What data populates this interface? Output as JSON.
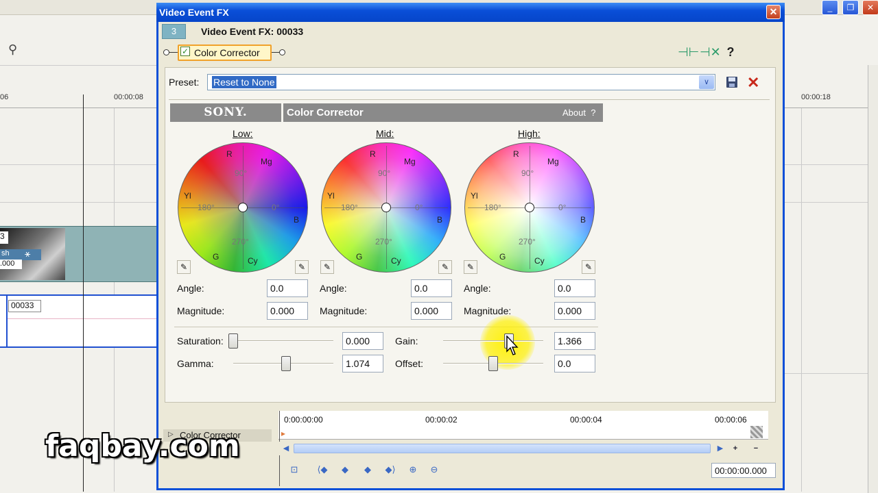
{
  "background": {
    "ruler_ticks": [
      "06",
      "00:00:08",
      "00:00:18"
    ],
    "clip_number": "3",
    "clip_label": "sh",
    "clip_value": ".000",
    "audio_clip_label": "00033",
    "win_buttons": [
      "_",
      "❐",
      "✕"
    ]
  },
  "dialog": {
    "title": "Video Event FX",
    "close_glyph": "✕",
    "fx_number": "3",
    "fx_title": "Video Event FX: 00033",
    "chain_plugin": "Color Corrector",
    "tool_icons": [
      "plug-in-chain-icon",
      "remove-plugin-icon",
      "help-icon"
    ],
    "help_glyph": "?",
    "preset": {
      "label": "Preset:",
      "value": "Reset to None",
      "dropdown_glyph": "∨"
    },
    "plugin_header": {
      "brand": "SONY.",
      "name": "Color Corrector",
      "about": "About",
      "about_help": "?"
    },
    "wheels": [
      {
        "label": "Low:",
        "angle_label": "Angle:",
        "angle": "0.0",
        "magnitude_label": "Magnitude:",
        "magnitude": "0.000"
      },
      {
        "label": "Mid:",
        "angle_label": "Angle:",
        "angle": "0.0",
        "magnitude_label": "Magnitude:",
        "magnitude": "0.000"
      },
      {
        "label": "High:",
        "angle_label": "Angle:",
        "angle": "0.0",
        "magnitude_label": "Magnitude:",
        "magnitude": "0.000"
      }
    ],
    "wheel_markers": {
      "r": "R",
      "mg": "Mg",
      "yl": "Yl",
      "b": "B",
      "g": "G",
      "cy": "Cy",
      "d90": "90°",
      "d180": "180°",
      "d0": "0°",
      "d270": "270°"
    },
    "sliders": {
      "saturation": {
        "label": "Saturation:",
        "value": "0.000",
        "position": 0.0
      },
      "gamma": {
        "label": "Gamma:",
        "value": "1.074",
        "position": 0.53
      },
      "gain": {
        "label": "Gain:",
        "value": "1.366",
        "position": 0.66
      },
      "offset": {
        "label": "Offset:",
        "value": "0.0",
        "position": 0.5
      }
    },
    "keyframes": {
      "track_label": "Color Corrector",
      "ruler": [
        "0:00:00:00",
        "00:00:02",
        "00:00:04",
        "00:00:06"
      ],
      "time": "00:00:00.000",
      "plus": "+",
      "minus": "−"
    }
  },
  "watermark": "faqbay.com",
  "colors": {
    "title_bar": "#0a4fd8",
    "accent_highlight": "#ffeb00",
    "chain_border": "#f0a12a"
  }
}
